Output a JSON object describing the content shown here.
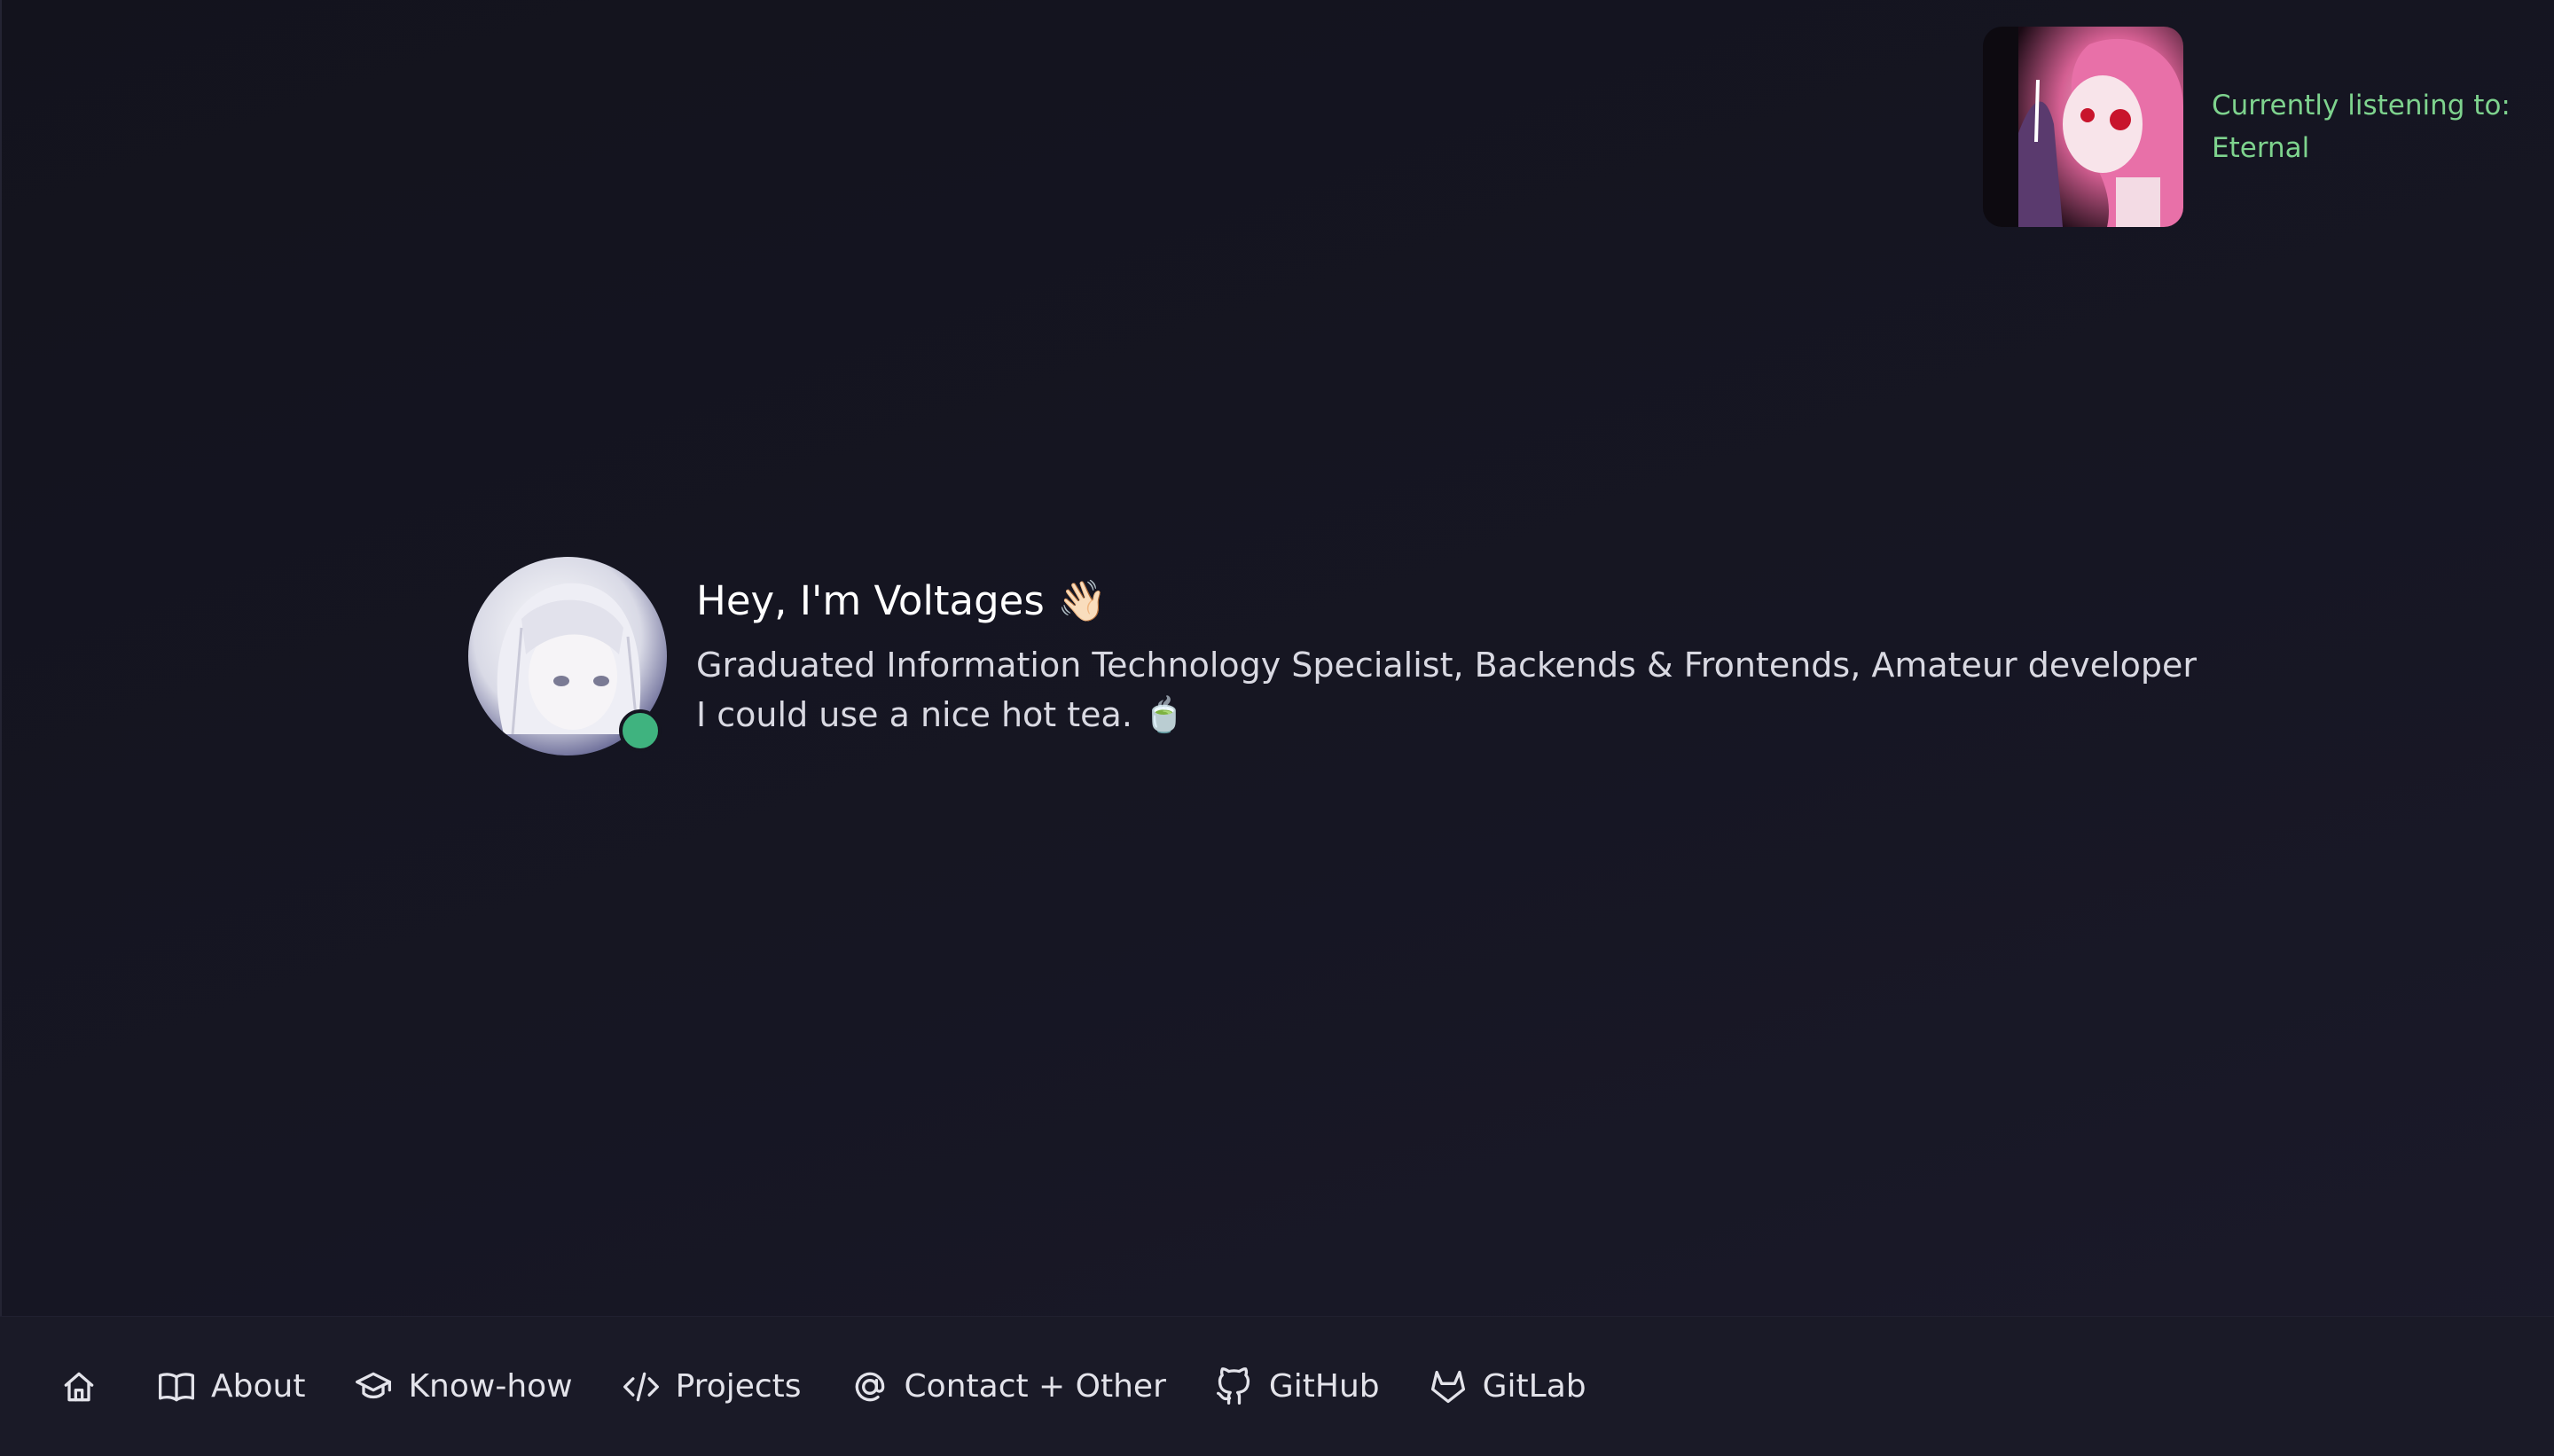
{
  "now_playing": {
    "label": "Currently listening to:",
    "track": "Eternal",
    "color": "#7ed38e",
    "cover_icon": "album-cover"
  },
  "profile": {
    "greeting": "Hey, I'm Voltages 👋🏻",
    "line1": "Graduated Information Technology Specialist, Backends & Frontends, Amateur developer",
    "line2": "I could use a nice hot tea. 🍵",
    "status_color": "#3fb37f",
    "avatar_icon": "avatar"
  },
  "nav": {
    "home_icon": "home-icon",
    "items": [
      {
        "label": "About",
        "icon": "book-icon"
      },
      {
        "label": "Know-how",
        "icon": "graduation-cap-icon"
      },
      {
        "label": "Projects",
        "icon": "code-icon"
      },
      {
        "label": "Contact + Other",
        "icon": "at-sign-icon"
      },
      {
        "label": "GitHub",
        "icon": "github-icon"
      },
      {
        "label": "GitLab",
        "icon": "gitlab-icon"
      }
    ]
  }
}
